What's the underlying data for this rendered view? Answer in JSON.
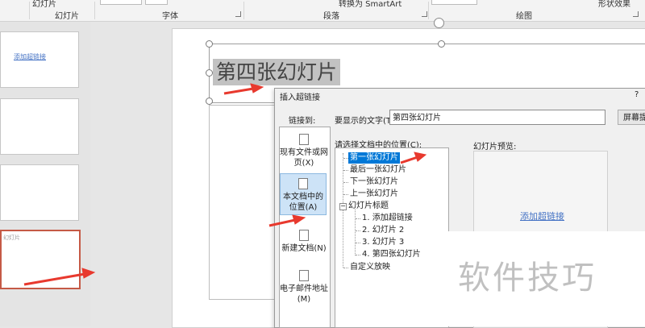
{
  "ribbon": {
    "groups": {
      "slides": "幻灯片",
      "font": "字体",
      "paragraph": "段落",
      "drawing": "绘图"
    },
    "fragments": {
      "new_slide": "幻灯片",
      "convert_smartart": "转换为 SmartArt",
      "shape_effects": "形状效果"
    }
  },
  "thumbnails": {
    "slide1_link": "添加超链接",
    "slide4_text": "幻灯片"
  },
  "slide": {
    "title": "第四张幻灯片"
  },
  "dialog": {
    "title": "插入超链接",
    "help": "?",
    "link_to": "链接到:",
    "display_text_label": "要显示的文字(T):",
    "display_text_value": "第四张幻灯片",
    "screentip_button": "屏幕提示(P)...",
    "nav": [
      {
        "label": "现有文件或网页(X)",
        "icon": "globe-file-icon"
      },
      {
        "label": "本文档中的位置(A)",
        "icon": "document-place-icon"
      },
      {
        "label": "新建文档(N)",
        "icon": "new-document-icon"
      },
      {
        "label": "电子邮件地址(M)",
        "icon": "email-icon"
      }
    ],
    "place_label": "请选择文档中的位置(C):",
    "tree": [
      "第一张幻灯片",
      "最后一张幻灯片",
      "下一张幻灯片",
      "上一张幻灯片",
      "幻灯片标题",
      "1. 添加超链接",
      "2. 幻灯片 2",
      "3. 幻灯片 3",
      "4. 第四张幻灯片",
      "自定义放映"
    ],
    "preview_label": "幻灯片预览:",
    "preview_link": "添加超链接"
  },
  "watermark": "软件技巧",
  "colors": {
    "selection": "#0078d7",
    "arrow": "#e8392e",
    "link": "#4472c4",
    "selected_thumb_border": "#c55a46"
  }
}
